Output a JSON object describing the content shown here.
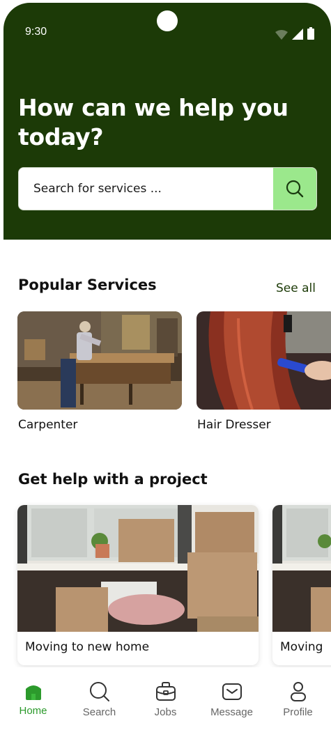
{
  "status_bar": {
    "time": "9:30",
    "icons": [
      "wifi-icon",
      "signal-icon",
      "battery-icon"
    ]
  },
  "header": {
    "headline": "How can we help you today?",
    "search": {
      "placeholder": "Search for services ...",
      "value": "",
      "icon": "search-icon"
    },
    "colors": {
      "background": "#1c3a07",
      "search_button": "#9be88c"
    }
  },
  "popular_services": {
    "title": "Popular Services",
    "see_all_label": "See all",
    "items": [
      {
        "label": "Carpenter"
      },
      {
        "label": "Hair Dresser"
      }
    ]
  },
  "projects": {
    "title": "Get help with a project",
    "items": [
      {
        "label": "Moving to new home"
      },
      {
        "label": "Moving"
      }
    ]
  },
  "bottom_nav": {
    "items": [
      {
        "label": "Home",
        "icon": "home-icon",
        "active": true
      },
      {
        "label": "Search",
        "icon": "search-icon",
        "active": false
      },
      {
        "label": "Jobs",
        "icon": "briefcase-icon",
        "active": false
      },
      {
        "label": "Message",
        "icon": "mail-icon",
        "active": false
      },
      {
        "label": "Profile",
        "icon": "user-icon",
        "active": false
      }
    ],
    "active_color": "#2c9a2c"
  }
}
